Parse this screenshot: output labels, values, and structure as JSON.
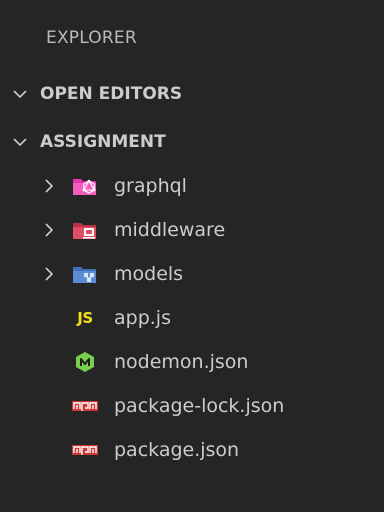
{
  "explorer": {
    "title": "EXPLORER",
    "sections": {
      "open_editors": {
        "label": "OPEN EDITORS",
        "icon": "chevron-down-icon"
      },
      "assignment": {
        "label": "ASSIGNMENT",
        "icon": "chevron-down-icon"
      }
    },
    "folders": [
      {
        "label": "graphql",
        "icon": "graphql-folder-icon",
        "color": "#e535ab"
      },
      {
        "label": "middleware",
        "icon": "middleware-folder-icon",
        "color": "#e04e5f"
      },
      {
        "label": "models",
        "icon": "models-folder-icon",
        "color": "#5a8dd6"
      }
    ],
    "files": [
      {
        "label": "app.js",
        "icon": "javascript-icon",
        "icon_text": "JS",
        "color": "#f5de19"
      },
      {
        "label": "nodemon.json",
        "icon": "nodemon-icon",
        "color": "#76d04b"
      },
      {
        "label": "package-lock.json",
        "icon": "npm-icon",
        "color": "#cb3837"
      },
      {
        "label": "package.json",
        "icon": "npm-icon",
        "color": "#cb3837"
      }
    ]
  }
}
